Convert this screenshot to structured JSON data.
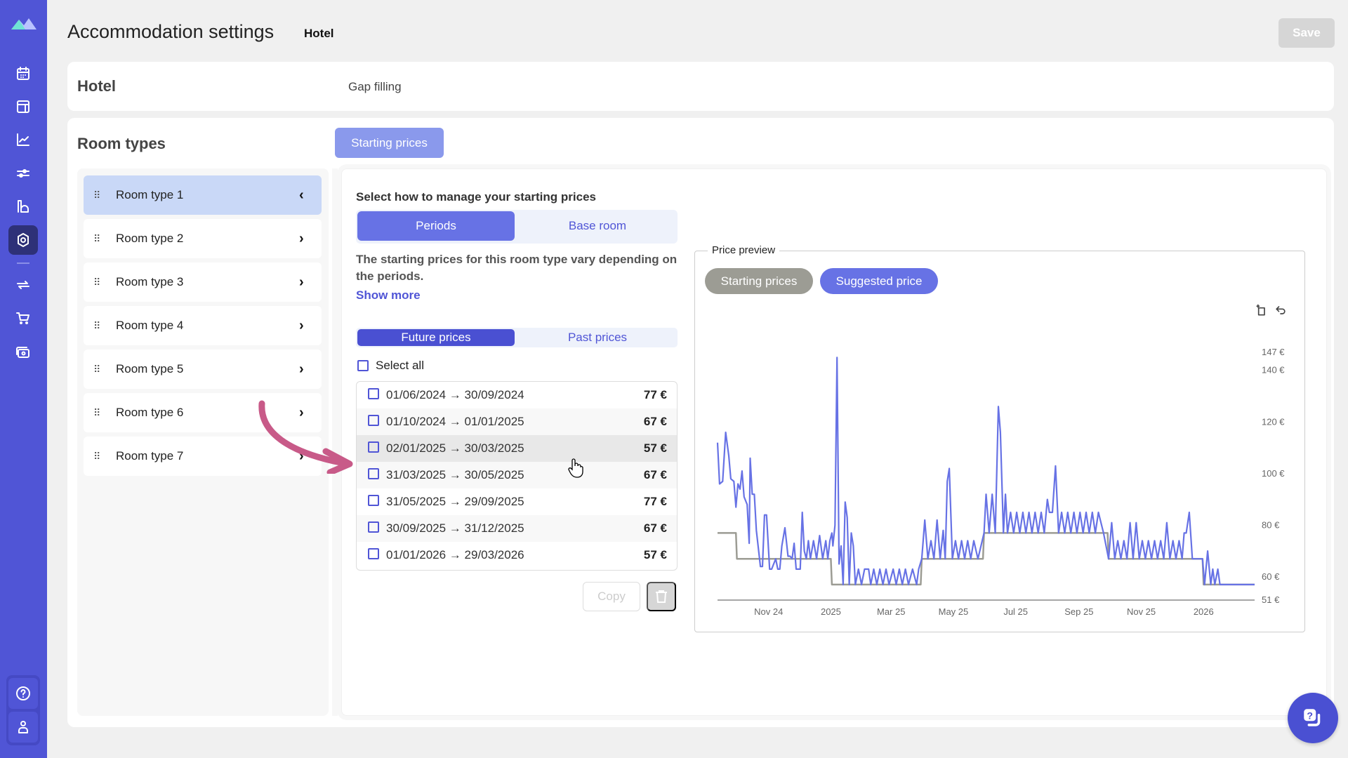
{
  "nav": {
    "items": [
      {
        "icon": "calendar-icon"
      },
      {
        "icon": "layout-icon"
      },
      {
        "icon": "chart-icon"
      },
      {
        "icon": "sliders-icon"
      },
      {
        "icon": "building-icon"
      },
      {
        "icon": "settings-icon",
        "active": true
      },
      {
        "icon": "sync-icon"
      },
      {
        "icon": "cart-icon"
      },
      {
        "icon": "camera-icon"
      }
    ],
    "bottom": [
      {
        "icon": "help-icon"
      },
      {
        "icon": "user-icon"
      }
    ]
  },
  "header": {
    "title": "Accommodation settings",
    "subtitle": "Hotel",
    "save_label": "Save"
  },
  "hotel_card": {
    "title": "Hotel",
    "tab": "Gap filling"
  },
  "room_types": {
    "title": "Room types",
    "active_tab": "Starting prices",
    "items": [
      "Room type 1",
      "Room type 2",
      "Room type 3",
      "Room type 4",
      "Room type 5",
      "Room type 6",
      "Room type 7"
    ],
    "selected_index": 0
  },
  "starting_prices": {
    "question": "Select how to manage your starting prices",
    "modes": [
      "Periods",
      "Base room"
    ],
    "active_mode": "Periods",
    "description": "The starting prices for this room type vary depending on the periods.",
    "show_more": "Show more",
    "time_tabs": [
      "Future prices",
      "Past prices"
    ],
    "active_time_tab": "Future prices",
    "select_all": "Select all",
    "periods": [
      {
        "range": "01/06/2024 → 30/09/2024",
        "price": "77 €"
      },
      {
        "range": "01/10/2024 → 01/01/2025",
        "price": "67 €"
      },
      {
        "range": "02/01/2025 → 30/03/2025",
        "price": "57 €"
      },
      {
        "range": "31/03/2025 → 30/05/2025",
        "price": "67 €"
      },
      {
        "range": "31/05/2025 → 29/09/2025",
        "price": "77 €"
      },
      {
        "range": "30/09/2025 → 31/12/2025",
        "price": "67 €"
      },
      {
        "range": "01/01/2026 → 29/03/2026",
        "price": "57 €"
      }
    ],
    "copy_label": "Copy"
  },
  "preview": {
    "legend": "Price preview",
    "toggles": [
      "Starting prices",
      "Suggested price"
    ],
    "colors": {
      "starting": "#9c9c94",
      "suggested": "#6772e5"
    }
  },
  "chart_data": {
    "type": "line",
    "title": "Price preview",
    "xlabel": "",
    "ylabel": "",
    "x_tick_labels": [
      "Nov 24",
      "2025",
      "Mar 25",
      "May 25",
      "Jul 25",
      "Sep 25",
      "Nov 25",
      "2026"
    ],
    "x_ticks": [
      "2024-11-01",
      "2025-01-01",
      "2025-03-01",
      "2025-05-01",
      "2025-07-01",
      "2025-09-01",
      "2025-11-01",
      "2026-01-01"
    ],
    "y_tick_labels": [
      "51 €",
      "60 €",
      "80 €",
      "100 €",
      "120 €",
      "140 €",
      "147 €"
    ],
    "y_ticks": [
      51,
      60,
      80,
      100,
      120,
      140,
      147
    ],
    "ylim": [
      51,
      147
    ],
    "xlim": [
      "2024-09-12",
      "2026-02-20"
    ],
    "grid": false,
    "legend": "top-left",
    "series": [
      {
        "name": "Starting prices",
        "color": "#9c9c94",
        "step": true,
        "points": [
          [
            "2024-09-12",
            77
          ],
          [
            "2024-09-30",
            77
          ],
          [
            "2024-10-01",
            67
          ],
          [
            "2025-01-01",
            67
          ],
          [
            "2025-01-02",
            57
          ],
          [
            "2025-03-30",
            57
          ],
          [
            "2025-03-31",
            67
          ],
          [
            "2025-05-30",
            67
          ],
          [
            "2025-05-31",
            77
          ],
          [
            "2025-09-29",
            77
          ],
          [
            "2025-09-30",
            67
          ],
          [
            "2025-12-31",
            67
          ],
          [
            "2026-01-01",
            57
          ],
          [
            "2026-02-20",
            57
          ]
        ]
      },
      {
        "name": "Suggested price",
        "color": "#6772e5",
        "points": [
          [
            "2024-09-12",
            112
          ],
          [
            "2024-09-14",
            96
          ],
          [
            "2024-09-17",
            97
          ],
          [
            "2024-09-20",
            116
          ],
          [
            "2024-09-23",
            107
          ],
          [
            "2024-09-25",
            98
          ],
          [
            "2024-09-28",
            97
          ],
          [
            "2024-09-30",
            87
          ],
          [
            "2024-10-02",
            96
          ],
          [
            "2024-10-04",
            94
          ],
          [
            "2024-10-06",
            101
          ],
          [
            "2024-10-08",
            91
          ],
          [
            "2024-10-11",
            88
          ],
          [
            "2024-10-13",
            73
          ],
          [
            "2024-10-14",
            106
          ],
          [
            "2024-10-16",
            92
          ],
          [
            "2024-10-18",
            92
          ],
          [
            "2024-10-20",
            78
          ],
          [
            "2024-10-24",
            64
          ],
          [
            "2024-10-26",
            64
          ],
          [
            "2024-10-28",
            84
          ],
          [
            "2024-10-30",
            84
          ],
          [
            "2024-11-02",
            63
          ],
          [
            "2024-11-04",
            63
          ],
          [
            "2024-11-06",
            65
          ],
          [
            "2024-11-08",
            67
          ],
          [
            "2024-11-10",
            63
          ],
          [
            "2024-11-12",
            63
          ],
          [
            "2024-11-14",
            72
          ],
          [
            "2024-11-17",
            79
          ],
          [
            "2024-11-20",
            68
          ],
          [
            "2024-11-22",
            68
          ],
          [
            "2024-11-24",
            67
          ],
          [
            "2024-11-26",
            73
          ],
          [
            "2024-11-28",
            63
          ],
          [
            "2024-11-30",
            63
          ],
          [
            "2024-12-02",
            63
          ],
          [
            "2024-12-04",
            85
          ],
          [
            "2024-12-06",
            70
          ],
          [
            "2024-12-08",
            67
          ],
          [
            "2024-12-10",
            74
          ],
          [
            "2024-12-12",
            67
          ],
          [
            "2024-12-15",
            74
          ],
          [
            "2024-12-18",
            67
          ],
          [
            "2024-12-21",
            76
          ],
          [
            "2024-12-24",
            67
          ],
          [
            "2024-12-27",
            74
          ],
          [
            "2024-12-29",
            67
          ],
          [
            "2024-12-31",
            74
          ],
          [
            "2025-01-02",
            77
          ],
          [
            "2025-01-03",
            72
          ],
          [
            "2025-01-05",
            80
          ],
          [
            "2025-01-07",
            145
          ],
          [
            "2025-01-09",
            65
          ],
          [
            "2025-01-11",
            72
          ],
          [
            "2025-01-13",
            57
          ],
          [
            "2025-01-15",
            89
          ],
          [
            "2025-01-17",
            83
          ],
          [
            "2025-01-19",
            57
          ],
          [
            "2025-01-21",
            77
          ],
          [
            "2025-01-23",
            72
          ],
          [
            "2025-01-25",
            57
          ],
          [
            "2025-01-28",
            63
          ],
          [
            "2025-01-31",
            57
          ],
          [
            "2025-02-03",
            63
          ],
          [
            "2025-02-05",
            63
          ],
          [
            "2025-02-07",
            63
          ],
          [
            "2025-02-09",
            57
          ],
          [
            "2025-02-12",
            63
          ],
          [
            "2025-02-15",
            57
          ],
          [
            "2025-02-18",
            63
          ],
          [
            "2025-02-21",
            57
          ],
          [
            "2025-02-24",
            63
          ],
          [
            "2025-02-27",
            57
          ],
          [
            "2025-03-03",
            63
          ],
          [
            "2025-03-06",
            57
          ],
          [
            "2025-03-09",
            63
          ],
          [
            "2025-03-12",
            57
          ],
          [
            "2025-03-15",
            63
          ],
          [
            "2025-03-18",
            57
          ],
          [
            "2025-03-22",
            63
          ],
          [
            "2025-03-26",
            57
          ],
          [
            "2025-03-28",
            63
          ],
          [
            "2025-03-31",
            67
          ],
          [
            "2025-04-03",
            82
          ],
          [
            "2025-04-06",
            67
          ],
          [
            "2025-04-09",
            74
          ],
          [
            "2025-04-12",
            67
          ],
          [
            "2025-04-15",
            82
          ],
          [
            "2025-04-18",
            67
          ],
          [
            "2025-04-21",
            78
          ],
          [
            "2025-04-23",
            67
          ],
          [
            "2025-04-25",
            97
          ],
          [
            "2025-04-27",
            102
          ],
          [
            "2025-04-30",
            67
          ],
          [
            "2025-05-03",
            74
          ],
          [
            "2025-05-06",
            67
          ],
          [
            "2025-05-09",
            74
          ],
          [
            "2025-05-12",
            67
          ],
          [
            "2025-05-15",
            74
          ],
          [
            "2025-05-18",
            67
          ],
          [
            "2025-05-21",
            74
          ],
          [
            "2025-05-25",
            67
          ],
          [
            "2025-05-31",
            77
          ],
          [
            "2025-06-02",
            92
          ],
          [
            "2025-06-05",
            77
          ],
          [
            "2025-06-08",
            92
          ],
          [
            "2025-06-11",
            77
          ],
          [
            "2025-06-14",
            126
          ],
          [
            "2025-06-16",
            116
          ],
          [
            "2025-06-19",
            77
          ],
          [
            "2025-06-21",
            92
          ],
          [
            "2025-06-23",
            77
          ],
          [
            "2025-06-26",
            85
          ],
          [
            "2025-06-29",
            77
          ],
          [
            "2025-07-02",
            85
          ],
          [
            "2025-07-05",
            77
          ],
          [
            "2025-07-08",
            85
          ],
          [
            "2025-07-11",
            77
          ],
          [
            "2025-07-14",
            85
          ],
          [
            "2025-07-17",
            77
          ],
          [
            "2025-07-20",
            85
          ],
          [
            "2025-07-23",
            77
          ],
          [
            "2025-07-26",
            85
          ],
          [
            "2025-07-29",
            77
          ],
          [
            "2025-08-01",
            90
          ],
          [
            "2025-08-03",
            85
          ],
          [
            "2025-08-06",
            85
          ],
          [
            "2025-08-09",
            103
          ],
          [
            "2025-08-12",
            77
          ],
          [
            "2025-08-15",
            85
          ],
          [
            "2025-08-18",
            77
          ],
          [
            "2025-08-21",
            85
          ],
          [
            "2025-08-24",
            77
          ],
          [
            "2025-08-27",
            85
          ],
          [
            "2025-08-30",
            77
          ],
          [
            "2025-09-02",
            85
          ],
          [
            "2025-09-05",
            77
          ],
          [
            "2025-09-08",
            85
          ],
          [
            "2025-09-11",
            77
          ],
          [
            "2025-09-14",
            85
          ],
          [
            "2025-09-17",
            77
          ],
          [
            "2025-09-20",
            85
          ],
          [
            "2025-09-25",
            77
          ],
          [
            "2025-09-30",
            67
          ],
          [
            "2025-10-03",
            81
          ],
          [
            "2025-10-06",
            67
          ],
          [
            "2025-10-09",
            74
          ],
          [
            "2025-10-12",
            67
          ],
          [
            "2025-10-15",
            74
          ],
          [
            "2025-10-18",
            67
          ],
          [
            "2025-10-21",
            81
          ],
          [
            "2025-10-24",
            67
          ],
          [
            "2025-10-27",
            81
          ],
          [
            "2025-10-30",
            67
          ],
          [
            "2025-11-02",
            74
          ],
          [
            "2025-11-05",
            67
          ],
          [
            "2025-11-08",
            74
          ],
          [
            "2025-11-11",
            67
          ],
          [
            "2025-11-14",
            74
          ],
          [
            "2025-11-17",
            67
          ],
          [
            "2025-11-20",
            74
          ],
          [
            "2025-11-23",
            67
          ],
          [
            "2025-11-26",
            81
          ],
          [
            "2025-11-29",
            67
          ],
          [
            "2025-12-02",
            74
          ],
          [
            "2025-12-05",
            67
          ],
          [
            "2025-12-08",
            74
          ],
          [
            "2025-12-11",
            67
          ],
          [
            "2025-12-13",
            77
          ],
          [
            "2025-12-15",
            77
          ],
          [
            "2025-12-18",
            85
          ],
          [
            "2025-12-21",
            67
          ],
          [
            "2025-12-31",
            67
          ],
          [
            "2026-01-02",
            57
          ],
          [
            "2026-01-05",
            70
          ],
          [
            "2026-01-08",
            57
          ],
          [
            "2026-01-10",
            63
          ],
          [
            "2026-01-12",
            57
          ],
          [
            "2026-01-15",
            63
          ],
          [
            "2026-01-17",
            57
          ],
          [
            "2026-02-20",
            57
          ]
        ]
      }
    ]
  }
}
